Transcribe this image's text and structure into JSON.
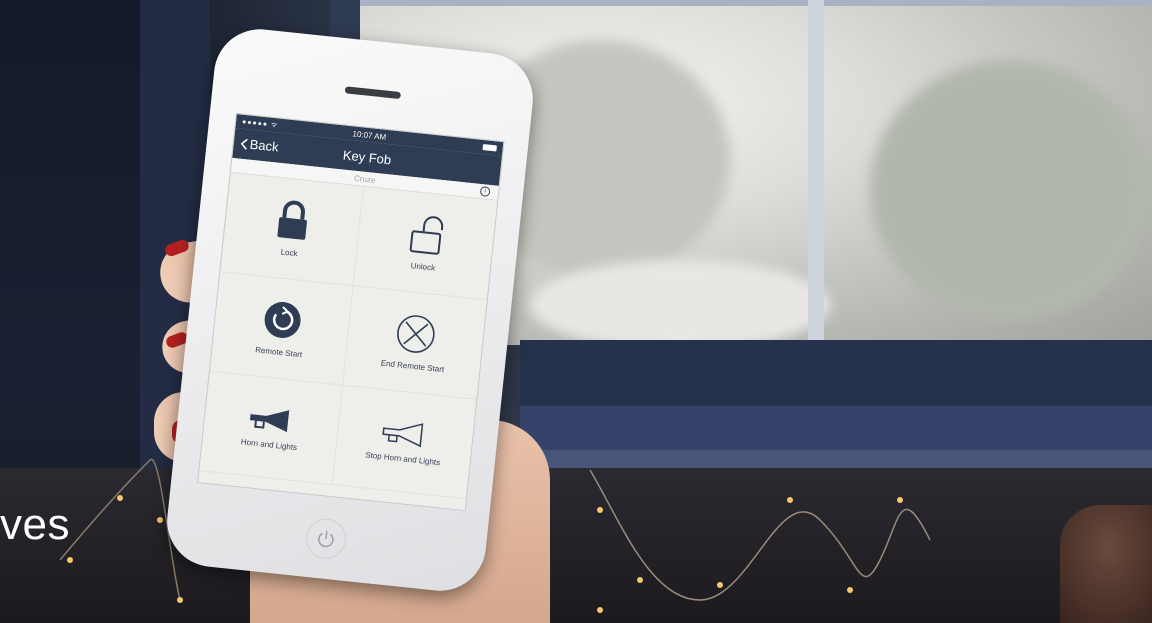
{
  "caption": {
    "text": "ves"
  },
  "phone": {
    "status": {
      "signal": "●●●●● ᯤ",
      "time": "10:07 AM"
    },
    "nav": {
      "back_label": "Back",
      "title": "Key Fob"
    },
    "subtitle": "Cruze",
    "actions": [
      {
        "label": "Lock",
        "icon": "lock-closed-icon"
      },
      {
        "label": "Unlock",
        "icon": "lock-open-icon"
      },
      {
        "label": "Remote Start",
        "icon": "remote-start-icon"
      },
      {
        "label": "End Remote Start",
        "icon": "end-remote-start-icon"
      },
      {
        "label": "Horn and Lights",
        "icon": "horn-icon"
      },
      {
        "label": "Stop Horn and Lights",
        "icon": "horn-outline-icon"
      }
    ],
    "accent_color": "#2e3c54",
    "nail_color": "#b3211f"
  }
}
